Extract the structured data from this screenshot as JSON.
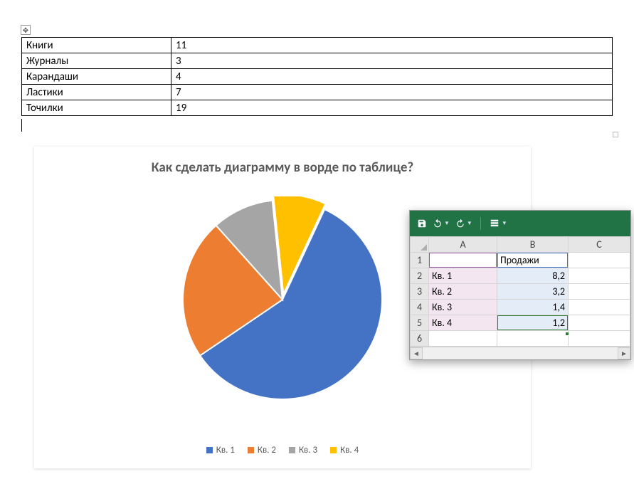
{
  "word_table": {
    "rows": [
      {
        "name": "Книги",
        "value": "11"
      },
      {
        "name": "Журналы",
        "value": "3"
      },
      {
        "name": "Карандаши",
        "value": "4"
      },
      {
        "name": "Ластики",
        "value": "7"
      },
      {
        "name": "Точилки",
        "value": "19"
      }
    ]
  },
  "chart": {
    "title": "Как сделать диаграмму в ворде по таблице?",
    "legend": [
      "Кв. 1",
      "Кв. 2",
      "Кв. 3",
      "Кв. 4"
    ],
    "colors": {
      "q1": "#4472C4",
      "q2": "#ED7D31",
      "q3": "#A5A5A5",
      "q4": "#FFC000"
    }
  },
  "chart_data": {
    "type": "pie",
    "title": "Как сделать диаграмму в ворде по таблице?",
    "categories": [
      "Кв. 1",
      "Кв. 2",
      "Кв. 3",
      "Кв. 4"
    ],
    "values": [
      8.2,
      3.2,
      1.4,
      1.2
    ],
    "colors": [
      "#4472C4",
      "#ED7D31",
      "#A5A5A5",
      "#FFC000"
    ]
  },
  "excel": {
    "columns": [
      "A",
      "B",
      "C"
    ],
    "header_b": "Продажи",
    "rows": [
      {
        "n": "1",
        "a": "",
        "b": "Продажи"
      },
      {
        "n": "2",
        "a": "Кв. 1",
        "b": "8,2"
      },
      {
        "n": "3",
        "a": "Кв. 2",
        "b": "3,2"
      },
      {
        "n": "4",
        "a": "Кв. 3",
        "b": "1,4"
      },
      {
        "n": "5",
        "a": "Кв. 4",
        "b": "1,2"
      },
      {
        "n": "6",
        "a": "",
        "b": ""
      }
    ]
  }
}
